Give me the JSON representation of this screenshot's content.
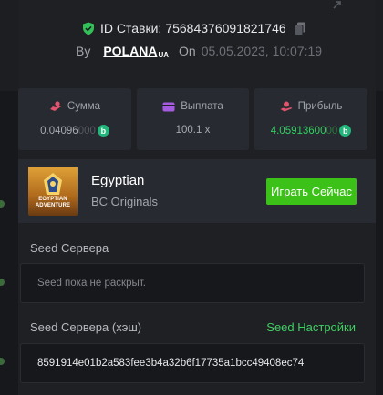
{
  "header": {
    "bet_id_label": "ID Ставки:",
    "bet_id": "75684376091821746",
    "by_label": "By",
    "username": "POLANA",
    "username_suffix": "UA",
    "on_label": "On",
    "date": "05.05.2023, 10:07:19"
  },
  "stats": [
    {
      "label": "Сумма",
      "value": "0.04096",
      "value_faded": "000",
      "coin": "b"
    },
    {
      "label": "Выплата",
      "value": "100.1 x"
    },
    {
      "label": "Прибыль",
      "value": "4.05913600",
      "value_faded": "00",
      "coin": "b"
    }
  ],
  "game": {
    "thumb_text_1": "EGYPTIAN",
    "thumb_text_2": "ADVENTURE",
    "title": "Egyptian",
    "provider": "BC Originals",
    "play_label": "Играть Сейчас"
  },
  "seed": {
    "server_seed_label": "Seed Сервера",
    "server_seed_value": "Seed пока не раскрыт.",
    "server_seed_hash_label": "Seed Сервера (хэш)",
    "settings_link": "Seed Настройки",
    "hash_value": "8591914e01b2a583fee3b4a32b6f17735a1bcc49408ec74"
  },
  "colors": {
    "accent_green": "#3bc117",
    "coin_green": "#23b67b",
    "profit_green": "#2fd160",
    "panel": "#1f2024",
    "card": "#272a30"
  }
}
